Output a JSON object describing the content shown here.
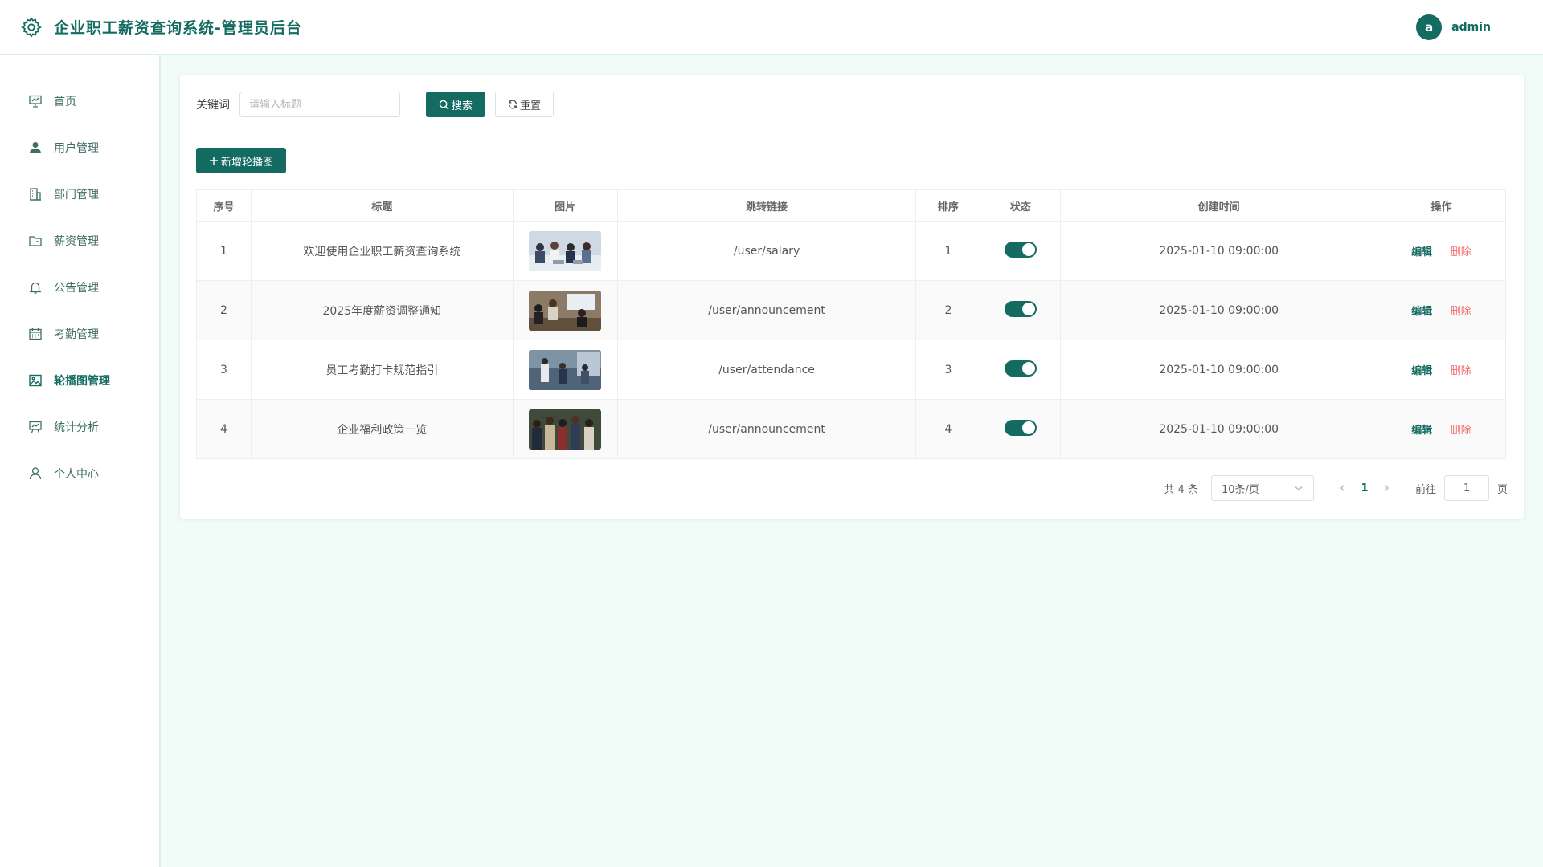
{
  "header": {
    "title": "企业职工薪资查询系统-管理员后台",
    "avatar_letter": "a",
    "username": "admin"
  },
  "sidebar": {
    "items": [
      {
        "label": "首页",
        "icon": "presentation-icon"
      },
      {
        "label": "用户管理",
        "icon": "user-icon"
      },
      {
        "label": "部门管理",
        "icon": "building-icon"
      },
      {
        "label": "薪资管理",
        "icon": "folder-icon"
      },
      {
        "label": "公告管理",
        "icon": "bell-icon"
      },
      {
        "label": "考勤管理",
        "icon": "calendar-icon"
      },
      {
        "label": "轮播图管理",
        "icon": "picture-icon",
        "active": true
      },
      {
        "label": "统计分析",
        "icon": "chart-board-icon"
      },
      {
        "label": "个人中心",
        "icon": "person-outline-icon"
      }
    ]
  },
  "search": {
    "label": "关键词",
    "placeholder": "请输入标题",
    "search_button": "搜索",
    "reset_button": "重置"
  },
  "add_button": "新增轮播图",
  "table": {
    "headers": [
      "序号",
      "标题",
      "图片",
      "跳转链接",
      "排序",
      "状态",
      "创建时间",
      "操作"
    ],
    "rows": [
      {
        "index": "1",
        "title": "欢迎使用企业职工薪资查询系统",
        "link": "/user/salary",
        "sort": "1",
        "status": true,
        "created": "2025-01-10 09:00:00"
      },
      {
        "index": "2",
        "title": "2025年度薪资调整通知",
        "link": "/user/announcement",
        "sort": "2",
        "status": true,
        "created": "2025-01-10 09:00:00"
      },
      {
        "index": "3",
        "title": "员工考勤打卡规范指引",
        "link": "/user/attendance",
        "sort": "3",
        "status": true,
        "created": "2025-01-10 09:00:00"
      },
      {
        "index": "4",
        "title": "企业福利政策一览",
        "link": "/user/announcement",
        "sort": "4",
        "status": true,
        "created": "2025-01-10 09:00:00"
      }
    ],
    "edit_label": "编辑",
    "delete_label": "删除"
  },
  "pagination": {
    "total_text": "共 4 条",
    "page_size": "10条/页",
    "current_page": "1",
    "goto_label": "前往",
    "goto_value": "1",
    "goto_suffix": "页"
  },
  "colors": {
    "primary": "#146b62",
    "danger": "#f56c6c",
    "background": "#f1fbf8"
  }
}
